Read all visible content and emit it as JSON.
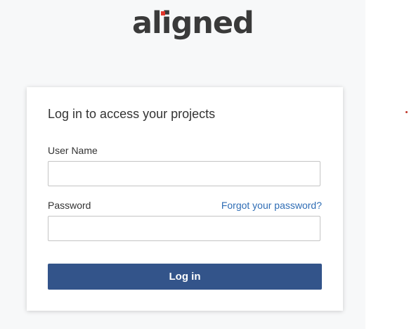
{
  "brand": {
    "logo_text": "aligned",
    "accent_color": "#e0352b"
  },
  "login_form": {
    "title": "Log in to access your projects",
    "username_label": "User Name",
    "username_value": "",
    "password_label": "Password",
    "password_value": "",
    "forgot_password_link": "Forgot your password?",
    "submit_label": "Log in",
    "button_color": "#33548a",
    "link_color": "#2f6db5"
  }
}
